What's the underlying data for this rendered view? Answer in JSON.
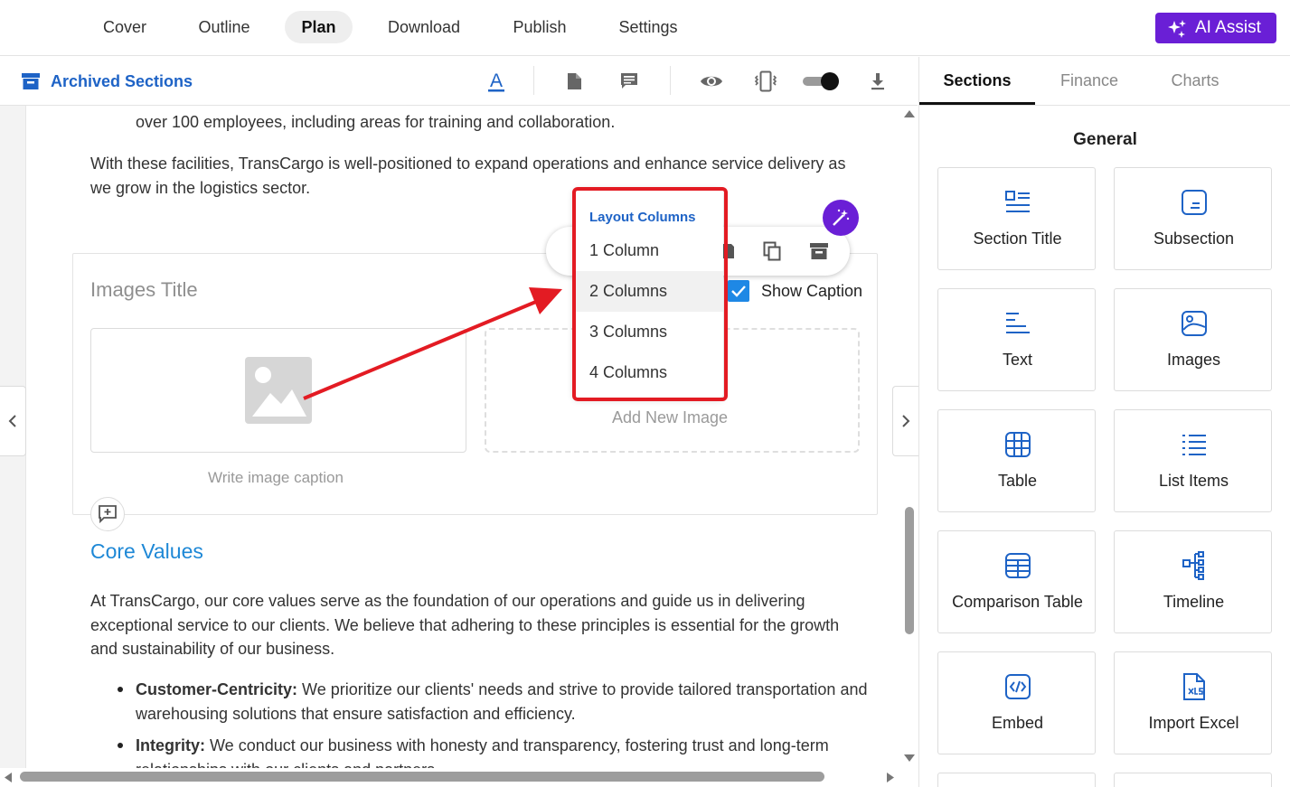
{
  "nav": {
    "tabs": [
      "Cover",
      "Outline",
      "Plan",
      "Download",
      "Publish",
      "Settings"
    ],
    "active_tab": "Plan",
    "ai_assist_label": "AI Assist"
  },
  "toolbar": {
    "archived_label": "Archived Sections"
  },
  "document": {
    "para_top_partial": "over 100 employees, including areas for training and collaboration.",
    "para_facilities": "With these facilities, TransCargo is well-positioned to expand operations and enhance service delivery as we grow in the logistics sector.",
    "images_block": {
      "title_placeholder": "Images Title",
      "caption_placeholder": "Write image caption",
      "add_new_label": "Add New Image",
      "show_caption_label": "Show Caption",
      "show_caption_checked": true
    },
    "core_values_title": "Core Values",
    "core_values_para": "At TransCargo, our core values serve as the foundation of our operations and guide us in delivering exceptional service to our clients. We believe that adhering to these principles is essential for the growth and sustainability of our business.",
    "bullets": [
      {
        "term": "Customer-Centricity:",
        "text": " We prioritize our clients' needs and strive to provide tailored transportation and warehousing solutions that ensure satisfaction and efficiency."
      },
      {
        "term": "Integrity:",
        "text": " We conduct our business with honesty and transparency, fostering trust and long-term relationships with our clients and partners."
      }
    ]
  },
  "layout_menu": {
    "heading": "Layout Columns",
    "items": [
      "1 Column",
      "2 Columns",
      "3 Columns",
      "4 Columns"
    ],
    "selected": "2 Columns"
  },
  "right_panel": {
    "tabs": [
      "Sections",
      "Finance",
      "Charts"
    ],
    "active_tab": "Sections",
    "group_title": "General",
    "cards": [
      {
        "label": "Section Title",
        "icon": "section-title-icon"
      },
      {
        "label": "Subsection",
        "icon": "subsection-icon"
      },
      {
        "label": "Text",
        "icon": "text-icon"
      },
      {
        "label": "Images",
        "icon": "images-icon"
      },
      {
        "label": "Table",
        "icon": "table-icon"
      },
      {
        "label": "List Items",
        "icon": "list-items-icon"
      },
      {
        "label": "Comparison Table",
        "icon": "comparison-table-icon"
      },
      {
        "label": "Timeline",
        "icon": "timeline-icon"
      },
      {
        "label": "Embed",
        "icon": "embed-icon"
      },
      {
        "label": "Import Excel",
        "icon": "import-excel-icon"
      }
    ]
  },
  "colors": {
    "accent_blue": "#1e63c6",
    "heading_blue": "#1e88d6",
    "ai_purple": "#6a1fd6",
    "highlight_red": "#e31b23"
  }
}
